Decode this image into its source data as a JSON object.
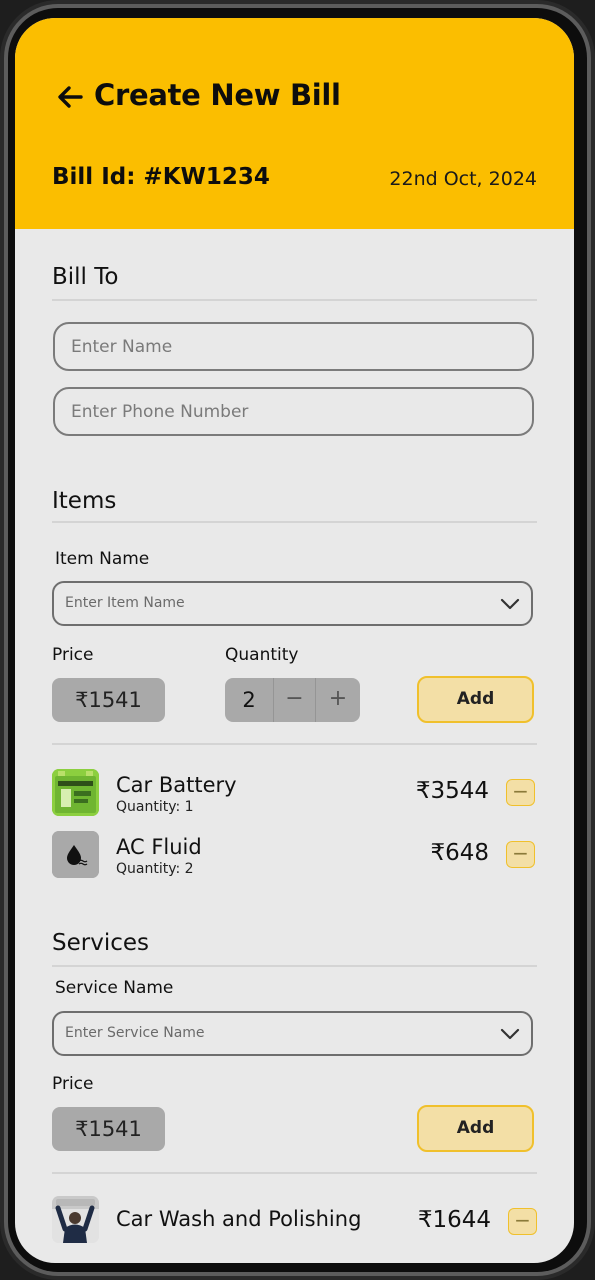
{
  "header": {
    "title": "Create New Bill",
    "bill_id": "Bill Id: #KW1234",
    "date": "22nd Oct, 2024"
  },
  "bill_to": {
    "title": "Bill To",
    "name_placeholder": "Enter Name",
    "phone_placeholder": "Enter Phone Number"
  },
  "items": {
    "title": "Items",
    "item_name_label": "Item Name",
    "item_name_placeholder": "Enter Item Name",
    "price_label": "Price",
    "price_value": "₹1541",
    "quantity_label": "Quantity",
    "quantity_value": "2",
    "minus": "−",
    "plus": "+",
    "add_label": "Add",
    "list": [
      {
        "name": "Car Battery",
        "quantity": "Quantity: 1",
        "price": "₹3544",
        "icon": "car-battery-icon"
      },
      {
        "name": "AC Fluid",
        "quantity": "Quantity: 2",
        "price": "₹648",
        "icon": "fluid-drop-icon"
      }
    ]
  },
  "services": {
    "title": "Services",
    "service_name_label": "Service Name",
    "service_name_placeholder": "Enter Service Name",
    "price_label": "Price",
    "price_value": "₹1541",
    "add_label": "Add",
    "list": [
      {
        "name": "Car Wash and Polishing",
        "price": "₹1644",
        "icon": "car-wash-icon"
      }
    ]
  },
  "remove_symbol": "−",
  "colors": {
    "accent": "#fbbe00",
    "background": "#e9e9e9",
    "button_fill": "#f3dfa6",
    "button_border": "#f0c02c",
    "pill": "#a9a9a9"
  }
}
